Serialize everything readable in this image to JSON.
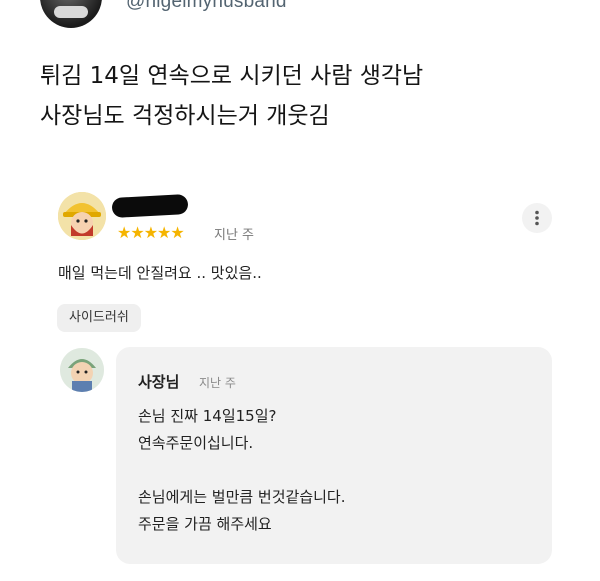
{
  "tweet": {
    "handle": "@nigelmyhusband",
    "lines": [
      "튀김 14일 연속으로 시키던 사람 생각남",
      "사장님도 걱정하시는거 개웃김"
    ]
  },
  "review": {
    "stars": "★★★★★",
    "rating": 5,
    "time": "지난 주",
    "body": "매일 먹는데 안질려요 .. 맛있음..",
    "menu_chip": "사이드러쉬",
    "star_color": "#f5b400"
  },
  "reply": {
    "name": "사장님",
    "time": "지난 주",
    "lines": [
      "손님 진짜 14일15일?",
      "연속주문이십니다.",
      "",
      "손님에게는 벌만큼 번것같습니다.",
      "주문을 가끔 해주세요"
    ]
  },
  "icons": {
    "more": "more-vertical-icon"
  }
}
